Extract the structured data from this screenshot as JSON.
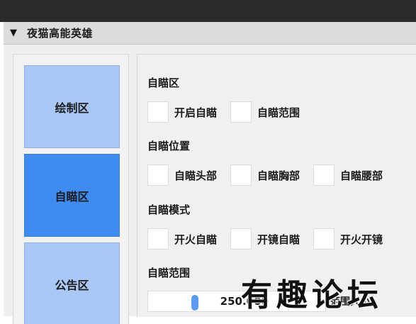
{
  "window": {
    "title": "夜猫高能英雄",
    "collapse_icon": "▼"
  },
  "nav": {
    "items": [
      {
        "label": "绘制区",
        "active": false
      },
      {
        "label": "自瞄区",
        "active": true
      },
      {
        "label": "公告区",
        "active": false
      }
    ]
  },
  "aim_section": {
    "title": "自瞄区",
    "options": [
      "开启自瞄",
      "自瞄范围"
    ]
  },
  "position_section": {
    "title": "自瞄位置",
    "options": [
      "自瞄头部",
      "自瞄胸部",
      "自瞄腰部"
    ]
  },
  "mode_section": {
    "title": "自瞄模式",
    "options": [
      "开火自瞄",
      "开镜自瞄",
      "开火开镜"
    ]
  },
  "range_section": {
    "title": "自瞄范围",
    "slider_value": "250.000",
    "slider_label": "范围大小"
  },
  "watermark": "有趣论坛",
  "colors": {
    "nav_inactive": "#a9c8f5",
    "nav_active": "#3f8cf0",
    "slider_thumb": "#5b9cf2"
  }
}
